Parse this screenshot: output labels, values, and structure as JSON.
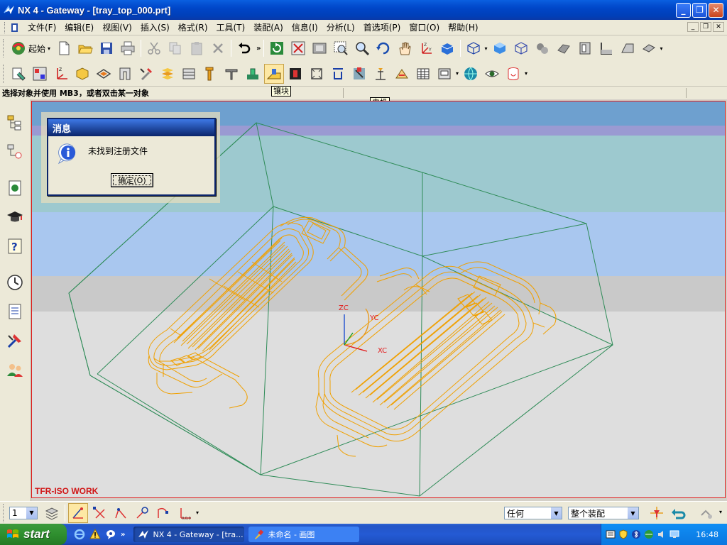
{
  "window": {
    "title": "NX 4 - Gateway - [tray_top_000.prt]",
    "minimize": "_",
    "maximize": "❐",
    "close": "✕"
  },
  "menu": {
    "items": [
      "文件(F)",
      "编辑(E)",
      "视图(V)",
      "插入(S)",
      "格式(R)",
      "工具(T)",
      "装配(A)",
      "信息(I)",
      "分析(L)",
      "首选项(P)",
      "窗口(O)",
      "帮助(H)"
    ],
    "mdi": [
      "_",
      "❐",
      "✕"
    ]
  },
  "toolbar": {
    "start_label": "起始",
    "overflow": "»",
    "tooltip_module": "镶块",
    "tooltip_electrode": "电极"
  },
  "cue": {
    "text": "选择对象并使用 MB3，或者双击某一对象"
  },
  "view": {
    "name": "TFR-ISO WORK",
    "axes": {
      "z": "ZC",
      "y": "YC",
      "x": "XC"
    },
    "background_colors": [
      "#6ea0cf",
      "#9a9ad2",
      "#9dc9cf",
      "#a9c7ef",
      "#c9c9c9",
      "#dedede"
    ],
    "wire_color": "#f0a000",
    "box_color": "#2e8b57"
  },
  "dialog": {
    "title": "消息",
    "message": "未找到注册文件",
    "ok": "确定(O)"
  },
  "selection": {
    "layer": "1",
    "filter": "任何",
    "scope": "整个装配"
  },
  "taskbar": {
    "start": "start",
    "tasks": [
      {
        "label": "NX 4 - Gateway - [tra..."
      },
      {
        "label": "未命名 - 画图"
      }
    ],
    "clock": "16:48"
  }
}
